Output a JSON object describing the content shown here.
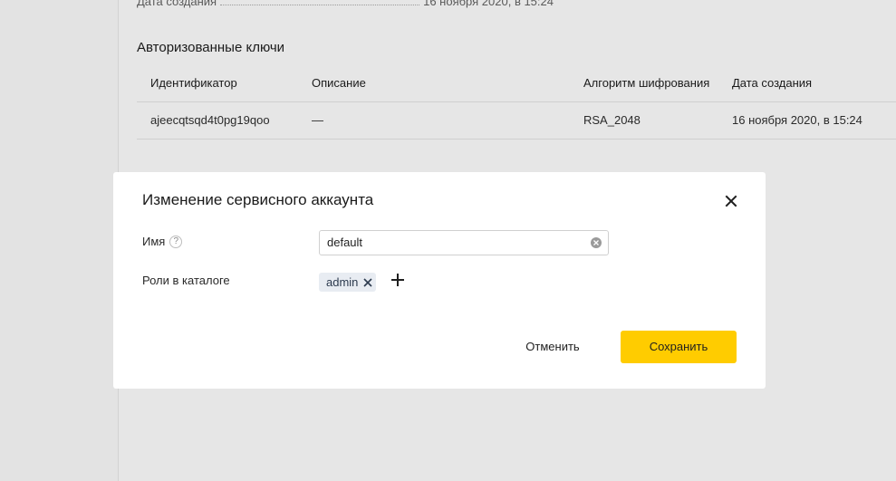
{
  "background": {
    "info_row": {
      "label": "Дата создания",
      "value": "16 ноября 2020, в 15:24"
    },
    "keys_section": {
      "title": "Авторизованные ключи",
      "columns": [
        "Идентификатор",
        "Описание",
        "Алгоритм шифрования",
        "Дата создания"
      ],
      "rows": [
        {
          "id": "ajeecqtsqd4t0pg19qoo",
          "description": "—",
          "algorithm": "RSA_2048",
          "created": "16 ноября 2020, в 15:24"
        }
      ]
    }
  },
  "modal": {
    "title": "Изменение сервисного аккаунта",
    "close_icon": "close-icon",
    "fields": {
      "name": {
        "label": "Имя",
        "help_icon": "?",
        "value": "default"
      },
      "roles": {
        "label": "Роли в каталоге",
        "chips": [
          "admin"
        ],
        "add_icon": "plus-icon"
      }
    },
    "buttons": {
      "cancel": "Отменить",
      "save": "Сохранить"
    }
  },
  "colors": {
    "primary_button": "#ffcc00",
    "overlay_background": "#e6e6e6",
    "modal_background": "#ffffff",
    "chip_background": "#e8ecf2"
  }
}
